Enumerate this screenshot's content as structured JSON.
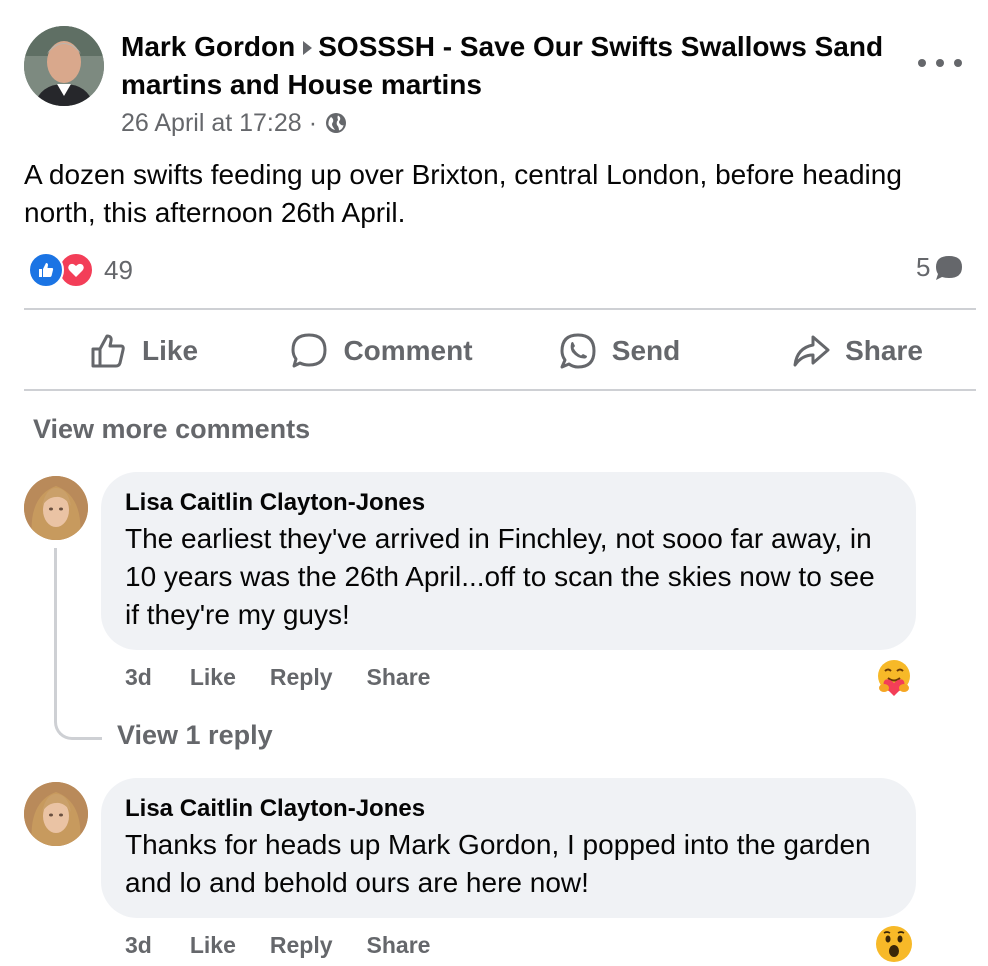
{
  "post": {
    "author": "Mark Gordon",
    "group": "SOSSSH - Save Our Swifts Swallows Sand martins and House martins",
    "timestamp": "26 April at 17:28",
    "separator": "·",
    "audience_icon": "globe-icon",
    "text": "A dozen swifts feeding up over Brixton, central London, before heading north, this afternoon 26th April.",
    "reactions": {
      "icons": [
        "like-icon",
        "love-icon"
      ],
      "count": "49"
    },
    "comment_count": "5",
    "actions": [
      {
        "label": "Like",
        "icon": "thumbs-up-icon"
      },
      {
        "label": "Comment",
        "icon": "comment-icon"
      },
      {
        "label": "Send",
        "icon": "whatsapp-icon"
      },
      {
        "label": "Share",
        "icon": "share-icon"
      }
    ]
  },
  "comments_section": {
    "view_more": "View more comments",
    "view_reply": "View 1 reply",
    "comments": [
      {
        "author": "Lisa Caitlin Clayton-Jones",
        "text": "The earliest they've arrived in Finchley, not sooo far away, in 10 years was the 26th April...off to scan the skies now to see if they're my guys!",
        "time": "3d",
        "actions": [
          "Like",
          "Reply",
          "Share"
        ],
        "reaction": "care-emoji"
      },
      {
        "author": "Lisa Caitlin Clayton-Jones",
        "text": "Thanks for heads up Mark Gordon, I popped into the garden and lo and behold ours are here now!",
        "time": "3d",
        "actions": [
          "Like",
          "Reply",
          "Share"
        ],
        "reaction": "wow-emoji"
      }
    ]
  },
  "colors": {
    "text_primary": "#050505",
    "text_secondary": "#65676b",
    "like_blue": "#1b74e4",
    "love_red": "#f33e58",
    "bubble_bg": "#f0f2f5",
    "divider": "#ced0d4"
  }
}
